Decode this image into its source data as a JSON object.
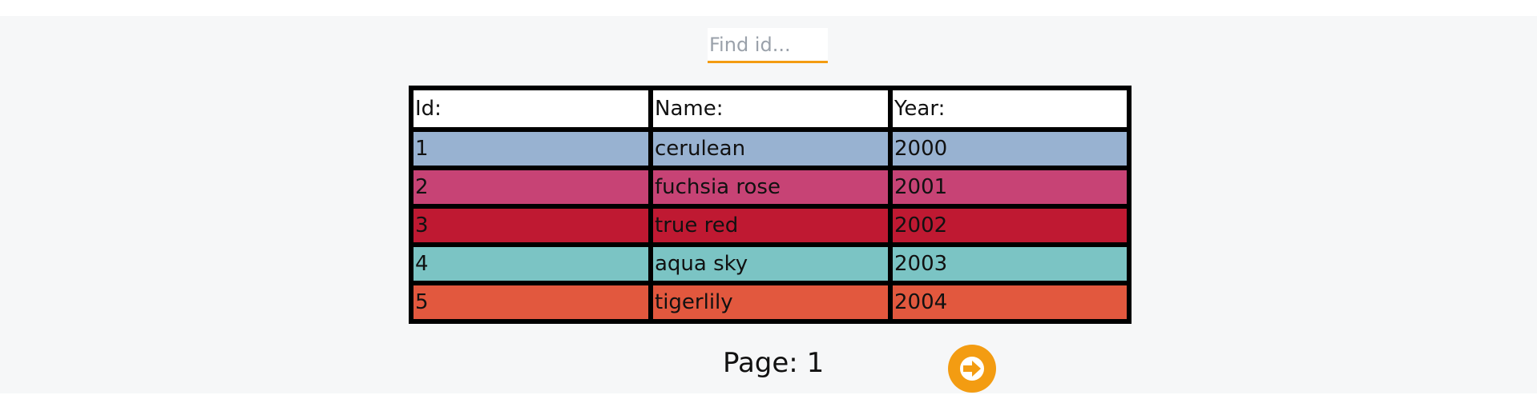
{
  "search": {
    "placeholder": "Find id...",
    "value": ""
  },
  "table": {
    "columns": [
      "Id:",
      "Name:",
      "Year:"
    ],
    "rows": [
      {
        "id": "1",
        "name": "cerulean",
        "year": "2000",
        "color": "#98b2d1"
      },
      {
        "id": "2",
        "name": "fuchsia rose",
        "year": "2001",
        "color": "#c74375"
      },
      {
        "id": "3",
        "name": "true red",
        "year": "2002",
        "color": "#bf1932"
      },
      {
        "id": "4",
        "name": "aqua sky",
        "year": "2003",
        "color": "#7bc4c4"
      },
      {
        "id": "5",
        "name": "tigerlily",
        "year": "2004",
        "color": "#e2583e"
      }
    ]
  },
  "pager": {
    "label": "Page: 1",
    "next_icon": "arrow-right-icon"
  },
  "colors": {
    "accent": "#f39c12",
    "background": "#f6f7f8"
  }
}
